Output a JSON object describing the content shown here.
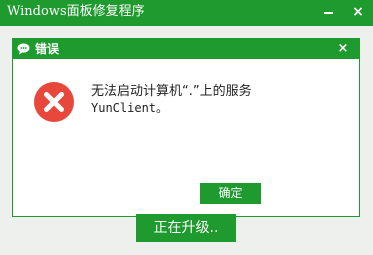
{
  "main_window": {
    "title": "Windows面板修复程序",
    "minimize_label": "—",
    "close_label": "×",
    "status_text": "正在升级.."
  },
  "dialog": {
    "title": "错误",
    "close_label": "×",
    "message_line1": "无法启动计算机“.”上的服务",
    "message_line2": "YunClient。",
    "ok_label": "确定",
    "icons": {
      "app": "chat-bubble-icon",
      "message": "error-x-icon"
    }
  },
  "colors": {
    "accent": "#1e9a2e",
    "error_red": "#e8483c",
    "background": "#eef0ee"
  }
}
